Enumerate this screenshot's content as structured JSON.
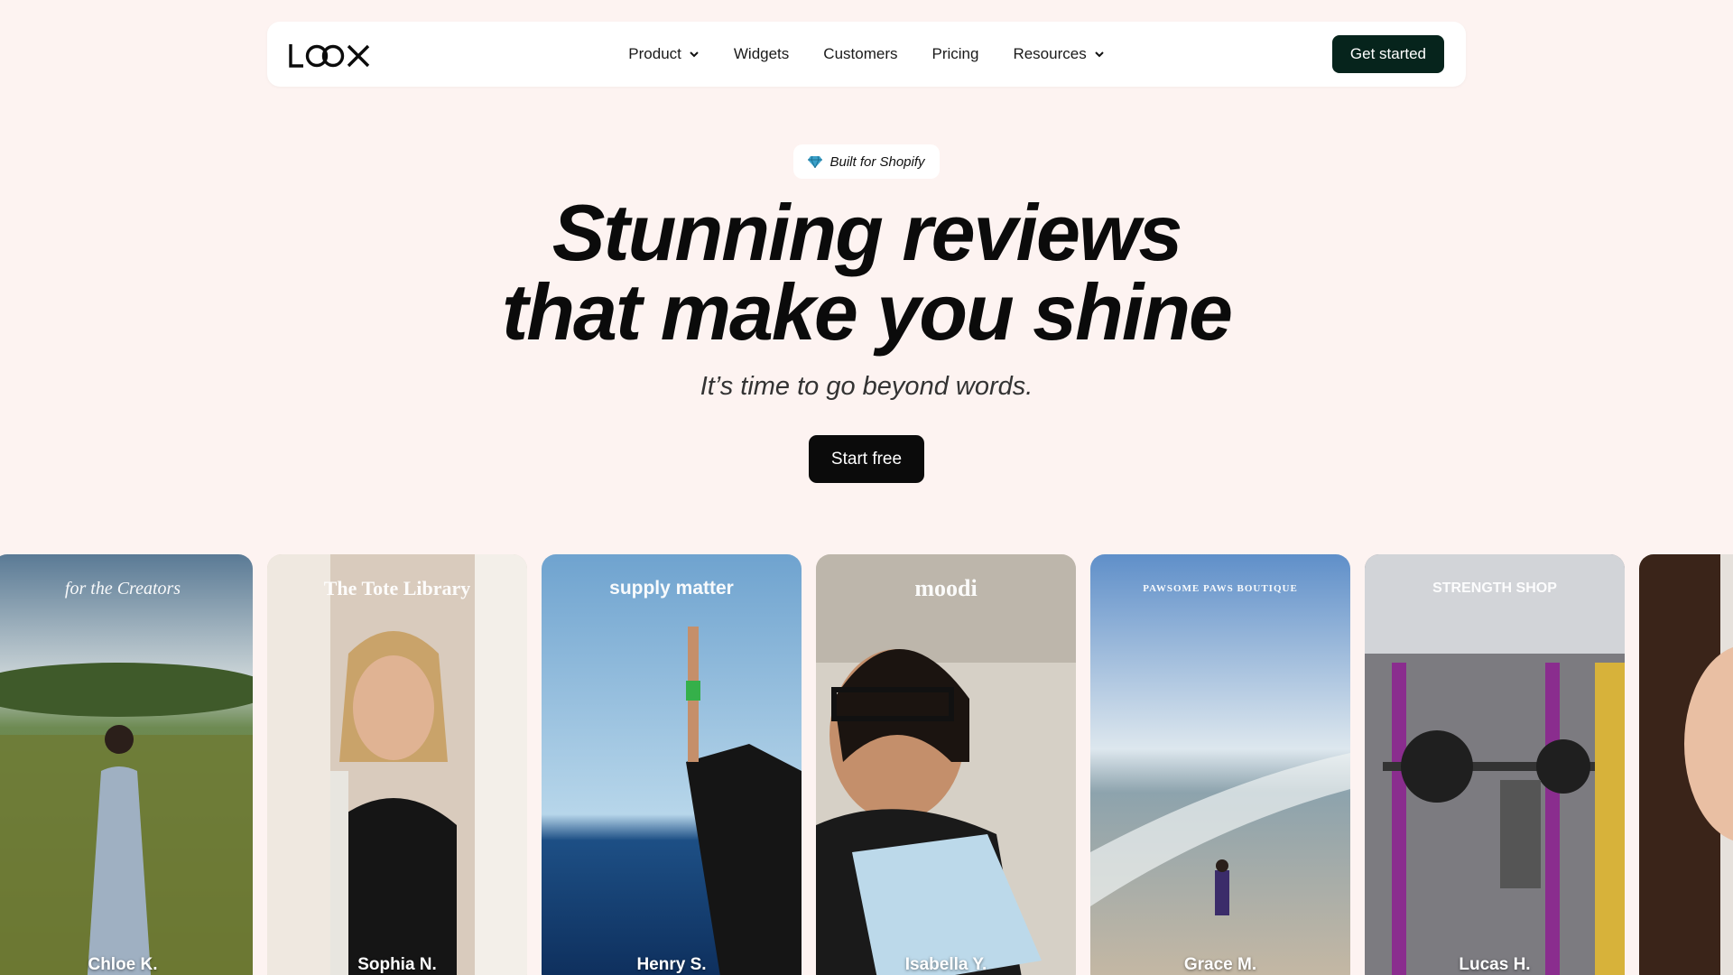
{
  "nav": {
    "logo": "LOOX",
    "links": [
      {
        "label": "Product",
        "has_dropdown": true
      },
      {
        "label": "Widgets",
        "has_dropdown": false
      },
      {
        "label": "Customers",
        "has_dropdown": false
      },
      {
        "label": "Pricing",
        "has_dropdown": false
      },
      {
        "label": "Resources",
        "has_dropdown": true
      }
    ],
    "cta": "Get started"
  },
  "hero": {
    "badge_icon": "gem-icon",
    "badge": "Built for Shopify",
    "headline_line1": "Stunning reviews",
    "headline_line2": "that make you shine",
    "subline": "It’s time to go beyond words.",
    "cta": "Start free"
  },
  "reviews": [
    {
      "brand": "for the Creators",
      "name": "Chloe K."
    },
    {
      "brand": "The Tote Library",
      "name": "Sophia N."
    },
    {
      "brand": "supply matter",
      "name": "Henry S."
    },
    {
      "brand": "moodi",
      "name": "Isabella Y."
    },
    {
      "brand": "PAWSOME PAWS BOUTIQUE",
      "name": "Grace M."
    },
    {
      "brand": "STRENGTH SHOP",
      "name": "Lucas H."
    },
    {
      "brand": "",
      "name": ""
    }
  ],
  "colors": {
    "page_bg": "#fdf3f1",
    "nav_cta_bg": "#06241c",
    "start_free_bg": "#0b0b0b"
  }
}
